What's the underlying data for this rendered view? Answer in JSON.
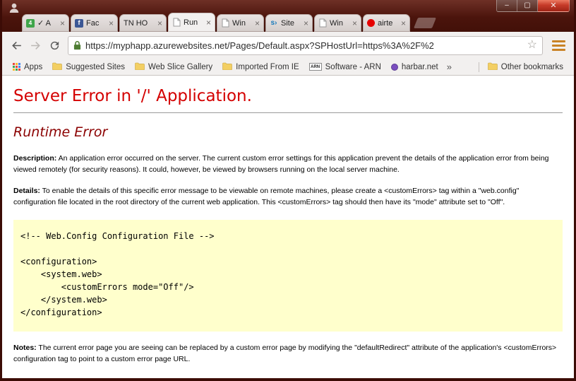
{
  "window": {
    "controls": {
      "minimize_glyph": "–",
      "maximize_glyph": "▢",
      "close_glyph": "✕"
    }
  },
  "glyphs": {
    "tab_close": "×",
    "bookmark_star": "☆",
    "overflow_chevron": "»"
  },
  "tabs": [
    {
      "label": "✓ A",
      "favicon_text": "4"
    },
    {
      "label": "Fac",
      "favicon_text": "f"
    },
    {
      "label": "TN HO"
    },
    {
      "label": "Run",
      "active": true
    },
    {
      "label": "Win"
    },
    {
      "label": "Site",
      "favicon_text": "s›"
    },
    {
      "label": "Win"
    },
    {
      "label": "airte"
    }
  ],
  "toolbar": {
    "url": "https://myphapp.azurewebsites.net/Pages/Default.aspx?SPHostUrl=https%3A%2F%2"
  },
  "bookmarks_bar": {
    "items": [
      {
        "label": "Apps"
      },
      {
        "label": "Suggested Sites"
      },
      {
        "label": "Web Slice Gallery"
      },
      {
        "label": "Imported From IE"
      },
      {
        "label": "Software - ARN",
        "badge": "ARN"
      },
      {
        "label": "harbar.net"
      }
    ],
    "overflow": "»",
    "other_bookmarks": "Other bookmarks"
  },
  "page": {
    "title": "Server Error in '/' Application.",
    "subtitle": "Runtime Error",
    "description": {
      "label": "Description:",
      "text": " An application error occurred on the server. The current custom error settings for this application prevent the details of the application error from being viewed remotely (for security reasons). It could, however, be viewed by browsers running on the local server machine."
    },
    "details": {
      "label": "Details:",
      "text": " To enable the details of this specific error message to be viewable on remote machines, please create a <customErrors> tag within a \"web.config\" configuration file located in the root directory of the current web application. This <customErrors> tag should then have its \"mode\" attribute set to \"Off\"."
    },
    "code": "<!-- Web.Config Configuration File -->\n\n<configuration>\n    <system.web>\n        <customErrors mode=\"Off\"/>\n    </system.web>\n</configuration>",
    "notes": {
      "label": "Notes:",
      "text": " The current error page you are seeing can be replaced by a custom error page by modifying the \"defaultRedirect\" attribute of the application's <customErrors> configuration tag to point to a custom error page URL."
    }
  },
  "colors": {
    "error_title": "#d40000",
    "runtime_error": "#8b0000",
    "code_background": "#ffffcc",
    "window_frame": "#3c0c06"
  }
}
